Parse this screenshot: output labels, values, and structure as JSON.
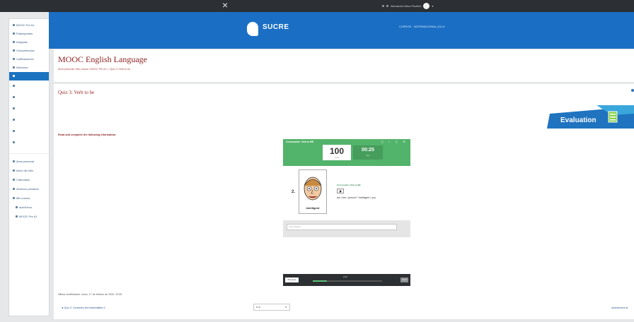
{
  "topbar": {
    "close_glyph": "×",
    "user_name": "Alexandra Nava Padrino"
  },
  "sidebar": {
    "items": [
      {
        "label": "MOOC Pre A1",
        "icon": "graduation-cap-icon"
      },
      {
        "label": "Participantes",
        "icon": "users-icon"
      },
      {
        "label": "Insignias",
        "icon": "badge-icon"
      },
      {
        "label": "Competencias",
        "icon": "check-square-icon"
      },
      {
        "label": "Calificaciones",
        "icon": "table-icon"
      },
      {
        "label": "Welcome",
        "icon": "folder-icon"
      },
      {
        "label": "",
        "icon": "folder-icon"
      },
      {
        "label": "",
        "icon": "folder-icon"
      },
      {
        "label": "",
        "icon": "folder-icon"
      },
      {
        "label": "",
        "icon": "folder-icon"
      },
      {
        "label": "",
        "icon": "folder-icon"
      },
      {
        "label": "",
        "icon": "folder-icon"
      },
      {
        "label": "",
        "icon": "folder-icon"
      },
      {
        "label": "Área personal",
        "icon": "home-icon"
      },
      {
        "label": "Inicio del sitio",
        "icon": "home-icon"
      },
      {
        "label": "Calendario",
        "icon": "calendar-icon"
      },
      {
        "label": "Archivos privados",
        "icon": "file-icon"
      },
      {
        "label": "Mis cursos",
        "icon": "graduation-cap-icon"
      },
      {
        "label": "autoServo",
        "icon": "graduation-cap-icon"
      },
      {
        "label": "MOOC Pre A1",
        "icon": "graduation-cap-icon"
      }
    ]
  },
  "banner": {
    "logo_text": "SUCRE",
    "logo_tagline": "",
    "course_menu": "CURSOS · INTERNACIONAL (21) ▾"
  },
  "header": {
    "title": "MOOC English Language",
    "breadcrumb": "Área personal  /  Mis cursos  /  MOOC Pre A1  /  /  Quiz 3: Verb to be"
  },
  "main": {
    "quiz_title": "Quiz 3: Verb to be",
    "evaluation_label": "Evaluation",
    "instructions": "Read and complete the following information."
  },
  "h5p": {
    "bar_title": "Crossroads: Verb to BE",
    "bar_icons": "▢ ◐ ▢ ⚙",
    "score": "100",
    "score_label": "score",
    "time": "00:25",
    "time_label": "time",
    "question_number": "2.",
    "picture_caption": "Intelligent",
    "question_title": "Crossroads: Verb to BE",
    "words": "am / Are / person? / intelligent / you",
    "answer_placeholder": "Your Answer",
    "prev_label": "Previous",
    "progress_text": "2/10",
    "progress_fraction": 0.2,
    "next_label": "Next"
  },
  "footer": {
    "last_modified": "Última modificación: lunes, 17 de febrero de 2020, 23:05",
    "prev_link": "◄ Quiz 2: Countries and Nationalities 2",
    "jump_value": "Ir a...",
    "next_link": "Assessment ►"
  },
  "colors": {
    "banner": "#1a6fc4",
    "title_red": "#8a1e1e",
    "h5p_green": "#52b36a",
    "active_item": "#1b73c0"
  }
}
